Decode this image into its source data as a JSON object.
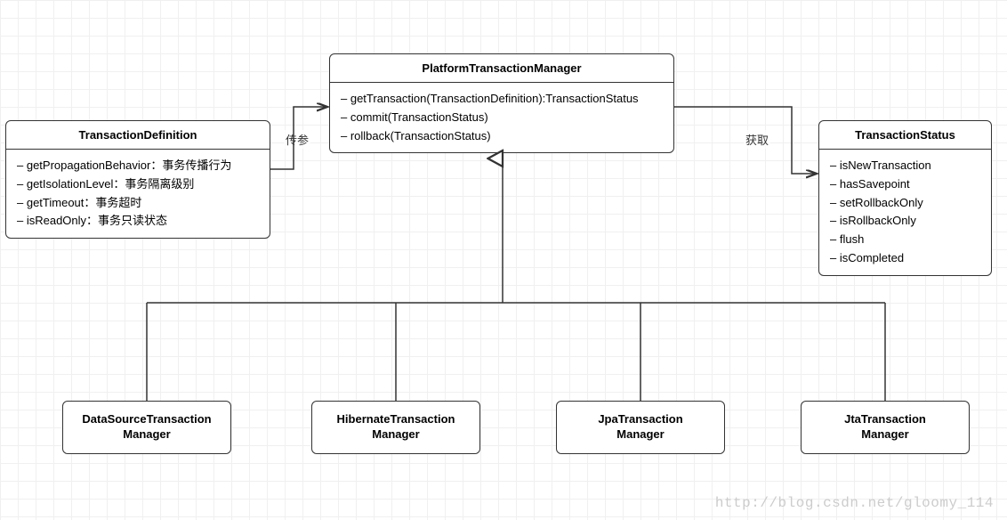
{
  "boxes": {
    "ptm": {
      "title": "PlatformTransactionManager",
      "items": [
        "getTransaction(TransactionDefinition):TransactionStatus",
        "commit(TransactionStatus)",
        "rollback(TransactionStatus)"
      ]
    },
    "td": {
      "title": "TransactionDefinition",
      "items": [
        "getPropagationBehavior：事务传播行为",
        "getIsolationLevel：事务隔离级别",
        "getTimeout：事务超时",
        "isReadOnly：事务只读状态"
      ]
    },
    "ts": {
      "title": "TransactionStatus",
      "items": [
        "isNewTransaction",
        "hasSavepoint",
        "setRollbackOnly",
        "isRollbackOnly",
        "flush",
        "isCompleted"
      ]
    },
    "impl1": {
      "line1": "DataSourceTransaction",
      "line2": "Manager"
    },
    "impl2": {
      "line1": "HibernateTransaction",
      "line2": "Manager"
    },
    "impl3": {
      "line1": "JpaTransaction",
      "line2": "Manager"
    },
    "impl4": {
      "line1": "JtaTransaction",
      "line2": "Manager"
    }
  },
  "labels": {
    "left": "传参",
    "right": "获取"
  },
  "watermark": "http://blog.csdn.net/gloomy_114"
}
